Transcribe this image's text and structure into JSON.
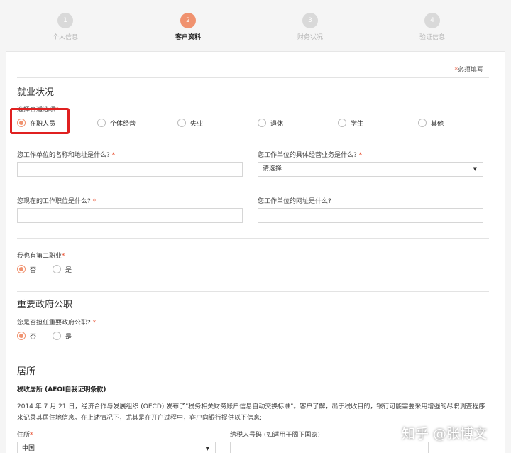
{
  "steps": [
    {
      "num": "1",
      "label": "个人信息",
      "state": "done"
    },
    {
      "num": "2",
      "label": "客户资料",
      "state": "active"
    },
    {
      "num": "3",
      "label": "财务状况",
      "state": "pending"
    },
    {
      "num": "4",
      "label": "验证信息",
      "state": "pending"
    }
  ],
  "form": {
    "required_star": "*",
    "required_note": "必须填写",
    "employment": {
      "title": "就业状况",
      "choose_label": "选择合适选项",
      "options": [
        "在职人员",
        "个体经营",
        "失业",
        "退休",
        "学生",
        "其他"
      ],
      "selected": "在职人员",
      "employer_name_label": "您工作单位的名称和地址是什么?",
      "employer_name_value": "",
      "business_label": "您工作单位的具体经营业务是什么?",
      "business_value": "请选择",
      "position_label": "您现在的工作职位是什么?",
      "position_value": "",
      "website_label": "您工作单位的网址是什么?",
      "website_value": "",
      "second_job_label": "我也有第二职业",
      "second_job_options": [
        "否",
        "是"
      ],
      "second_job_selected": "否"
    },
    "pep": {
      "title": "重要政府公职",
      "question": "您是否担任重要政府公职?",
      "options": [
        "否",
        "是"
      ],
      "selected": "否"
    },
    "residence": {
      "title": "居所",
      "subtitle": "税收居所 (AEOI自我证明条款)",
      "paragraph": "2014 年 7 月 21 日，经济合作与发展组织 (OECD) 发布了\"税务相关财务账户信息自动交换标准\"。客户了解，出于税收目的，银行可能需要采用增强的尽职调查程序来记录其居住地信息。在上述情况下，尤其是在开户过程中，客户向银行提供以下信息:",
      "country_label": "住所",
      "country_value": "中国",
      "tin_label": "纳税人号码 (如适用于阁下国家)",
      "tin_value": ""
    }
  },
  "colors": {
    "accent": "#f0926f",
    "required": "#e94e2f",
    "highlight": "#e02020"
  },
  "icons": {
    "dropdown": "caret-down-icon"
  },
  "watermark": "知乎 @张博文"
}
